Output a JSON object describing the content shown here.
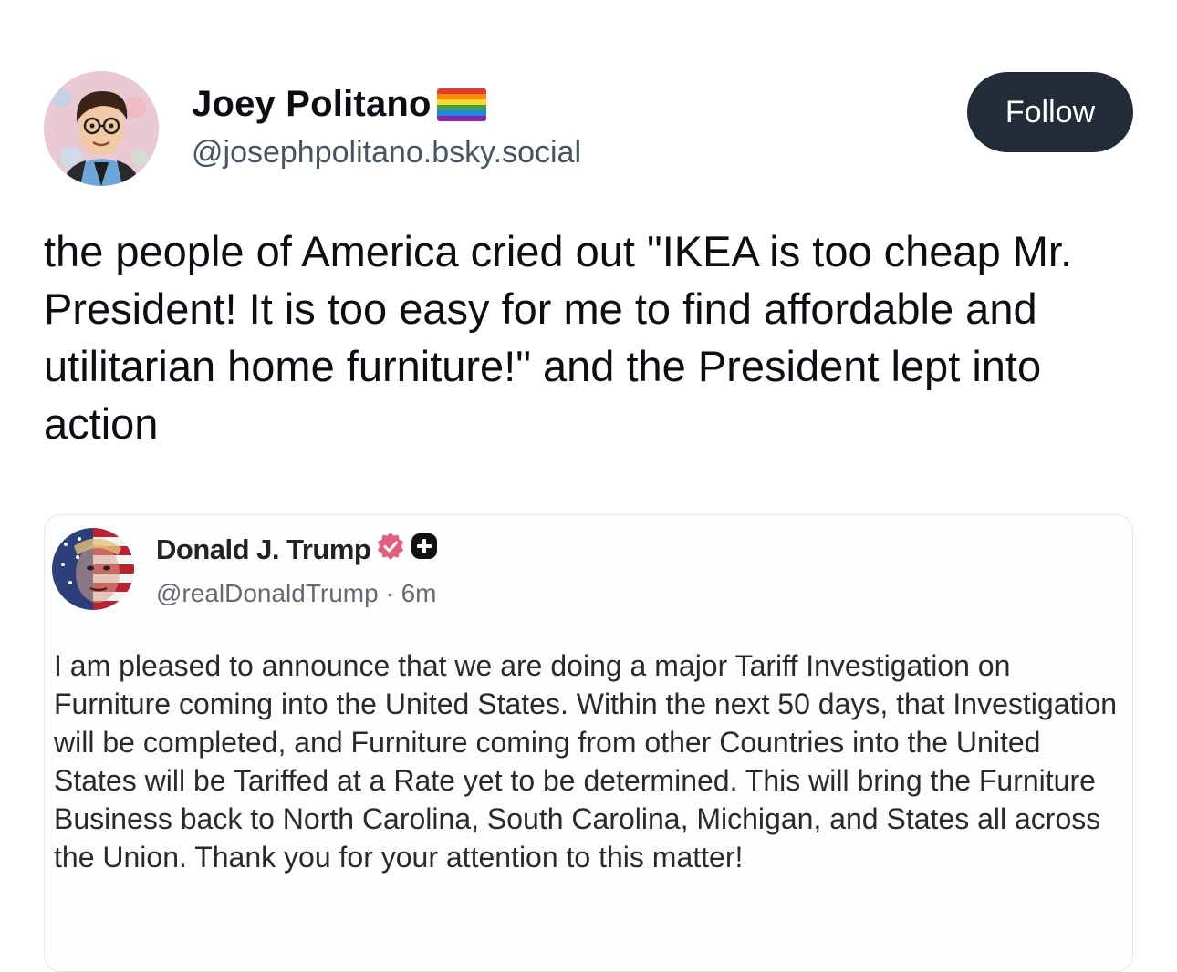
{
  "post": {
    "author": {
      "display_name": "Joey Politano",
      "name_emoji": "rainbow-flag-icon",
      "handle": "@josephpolitano.bsky.social",
      "avatar": "cartoon-avatar-glasses-tie"
    },
    "follow_label": "Follow",
    "text": "the people of America cried out \"IKEA is too cheap Mr. President! It is too easy for me to find affordable and utilitarian home furniture!\" and the President lept into action"
  },
  "embed": {
    "author": {
      "display_name": "Donald J. Trump",
      "verified_badge": "verified-badge-icon",
      "extra_badge": "plus-badge-icon",
      "handle": "@realDonaldTrump",
      "separator": " · ",
      "time": "6m",
      "avatar": "flag-face-avatar"
    },
    "text": "I am pleased to announce that we are doing a major Tariff Investigation on Furniture coming into the United States. Within the next 50 days, that Investigation will be completed, and Furniture coming from other Countries into the United States will be Tariffed at a Rate yet to be determined. This will bring the Furniture Business back to North Carolina, South Carolina, Michigan, and States all across the Union. Thank you for your attention to this matter!"
  },
  "colors": {
    "follow_bg": "#222b38",
    "handle": "#475463",
    "verified": "#e0607e",
    "embed_border": "#e3e6ea"
  }
}
